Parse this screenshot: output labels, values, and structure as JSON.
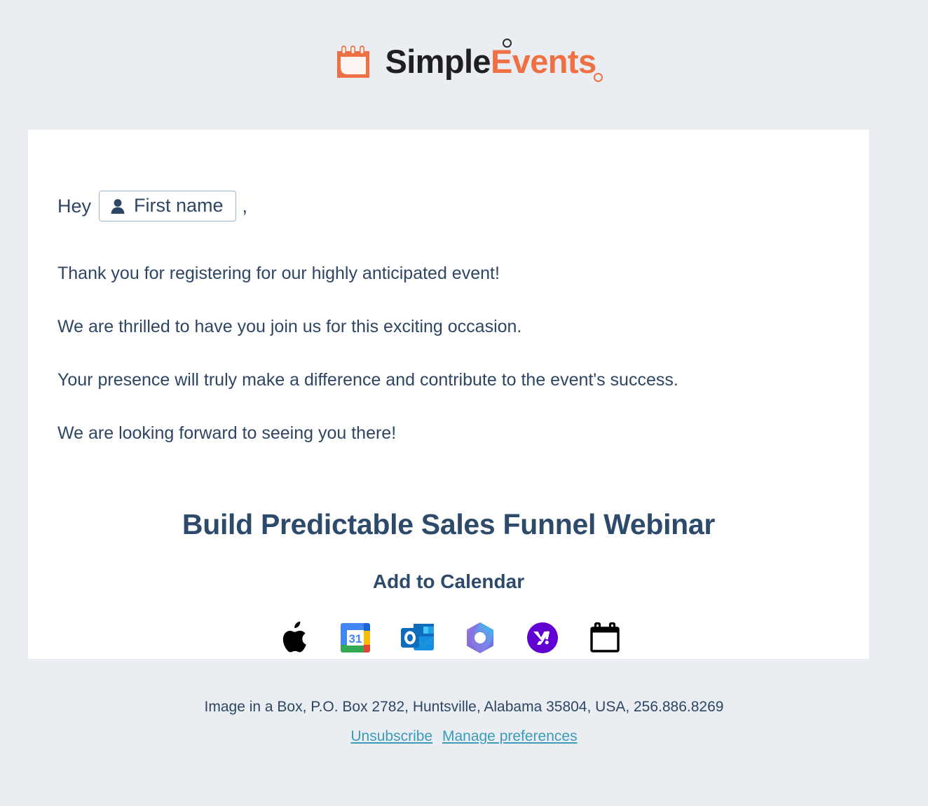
{
  "brand": {
    "name_part_dark": "Simple",
    "name_part_accent": "Events",
    "icon": "calendar-icon",
    "accent_color": "#ef7043",
    "dark_color": "#1f1f22"
  },
  "email": {
    "greeting_prefix": "Hey",
    "merge_tag_label": "First name",
    "merge_tag_icon": "person-icon",
    "greeting_suffix": ",",
    "paragraphs": [
      "Thank you for registering for our highly anticipated event!",
      "We are thrilled to have you join us for this exciting occasion.",
      "Your presence will truly make a difference and contribute to the event's success.",
      "We are looking forward to seeing you there!"
    ],
    "event_title": "Build Predictable Sales Funnel Webinar",
    "add_to_calendar_heading": "Add to Calendar",
    "calendar_buttons": [
      {
        "name": "apple-calendar",
        "label": "Apple"
      },
      {
        "name": "google-calendar",
        "label": "Google Calendar",
        "day_number": "31"
      },
      {
        "name": "outlook-calendar",
        "label": "Outlook"
      },
      {
        "name": "microsoft365-calendar",
        "label": "Microsoft 365"
      },
      {
        "name": "yahoo-calendar",
        "label": "Yahoo",
        "glyph": "y!"
      },
      {
        "name": "other-calendar",
        "label": "Other calendar"
      }
    ]
  },
  "footer": {
    "address": "Image in a Box, P.O. Box 2782, Huntsville, Alabama 35804, USA, 256.886.8269",
    "unsubscribe_label": "Unsubscribe",
    "manage_preferences_label": "Manage preferences",
    "link_color": "#3c9bb8"
  },
  "theme": {
    "page_background": "#eaeef2",
    "card_background": "#ffffff",
    "text_color": "#2e4663",
    "heading_color": "#2d4a6b"
  }
}
